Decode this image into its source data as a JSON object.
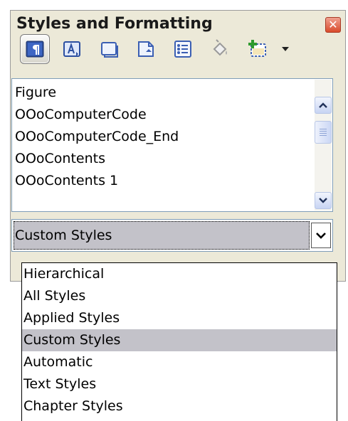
{
  "window": {
    "title": "Styles and Formatting",
    "close_label": "✕"
  },
  "toolbar": {
    "items": [
      {
        "name": "paragraph-styles-button",
        "icon": "paragraph-styles-icon",
        "active": true
      },
      {
        "name": "character-styles-button",
        "icon": "character-styles-icon"
      },
      {
        "name": "frame-styles-button",
        "icon": "frame-styles-icon"
      },
      {
        "name": "page-styles-button",
        "icon": "page-styles-icon"
      },
      {
        "name": "list-styles-button",
        "icon": "list-styles-icon"
      },
      {
        "name": "fill-format-mode-button",
        "icon": "paint-bucket-icon",
        "disabled": true
      },
      {
        "name": "new-style-from-selection-button",
        "icon": "new-style-icon"
      },
      {
        "name": "toolbar-menu-button",
        "icon": "dropdown-triangle-icon"
      }
    ]
  },
  "style_list": {
    "items": [
      "Figure",
      "OOoComputerCode",
      "OOoComputerCode_End",
      "OOoContents",
      "OOoContents 1"
    ]
  },
  "filter": {
    "selected": "Custom Styles",
    "options": [
      "Hierarchical",
      "All Styles",
      "Applied Styles",
      "Custom Styles",
      "Automatic",
      "Text Styles",
      "Chapter Styles"
    ]
  },
  "colors": {
    "panel_bg": "#ece9d8",
    "selection_bg": "#c3c2c9",
    "close_red": "#d94b2b",
    "scroll_blue": "#c7d4f3"
  }
}
